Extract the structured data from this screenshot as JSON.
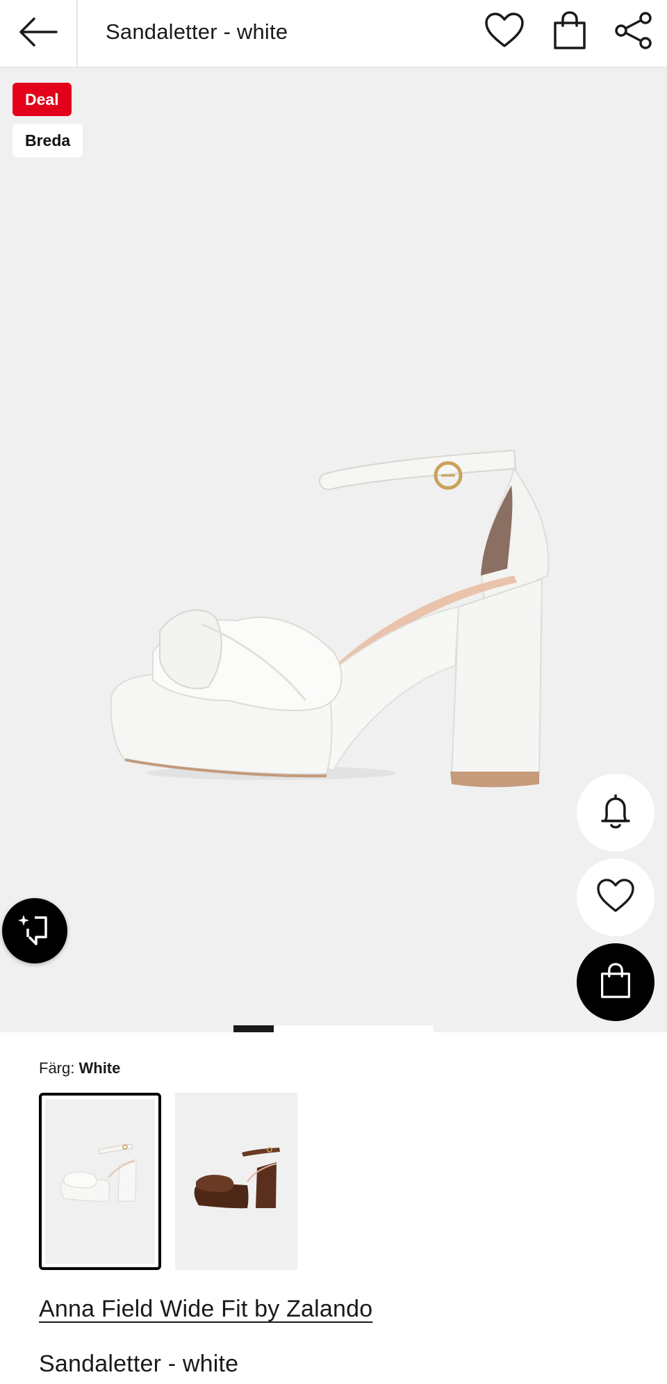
{
  "header": {
    "title": "Sandaletter - white",
    "icons": [
      "arrow-left-icon",
      "heart-icon",
      "shopping-bag-icon",
      "share-icon"
    ]
  },
  "gallery": {
    "badges": {
      "deal": "Deal",
      "brand": "Breda"
    },
    "image_description_icon": "white-platform-sandal-image",
    "page_index": 1,
    "actions": [
      "bell-icon",
      "heart-icon",
      "shopping-bag-icon",
      "similar-items-icon"
    ]
  },
  "colors": {
    "label": "Färg:",
    "selected": "White",
    "swatches": [
      {
        "name": "white",
        "color": "#f3f3f1"
      },
      {
        "name": "brown",
        "color": "#5a2f1d"
      }
    ]
  },
  "product": {
    "brand": "Anna Field Wide Fit by Zalando",
    "name": "Sandaletter - white"
  },
  "theme": {
    "accent": "#e2001a",
    "gallery_bg": "#f0f0f0"
  }
}
